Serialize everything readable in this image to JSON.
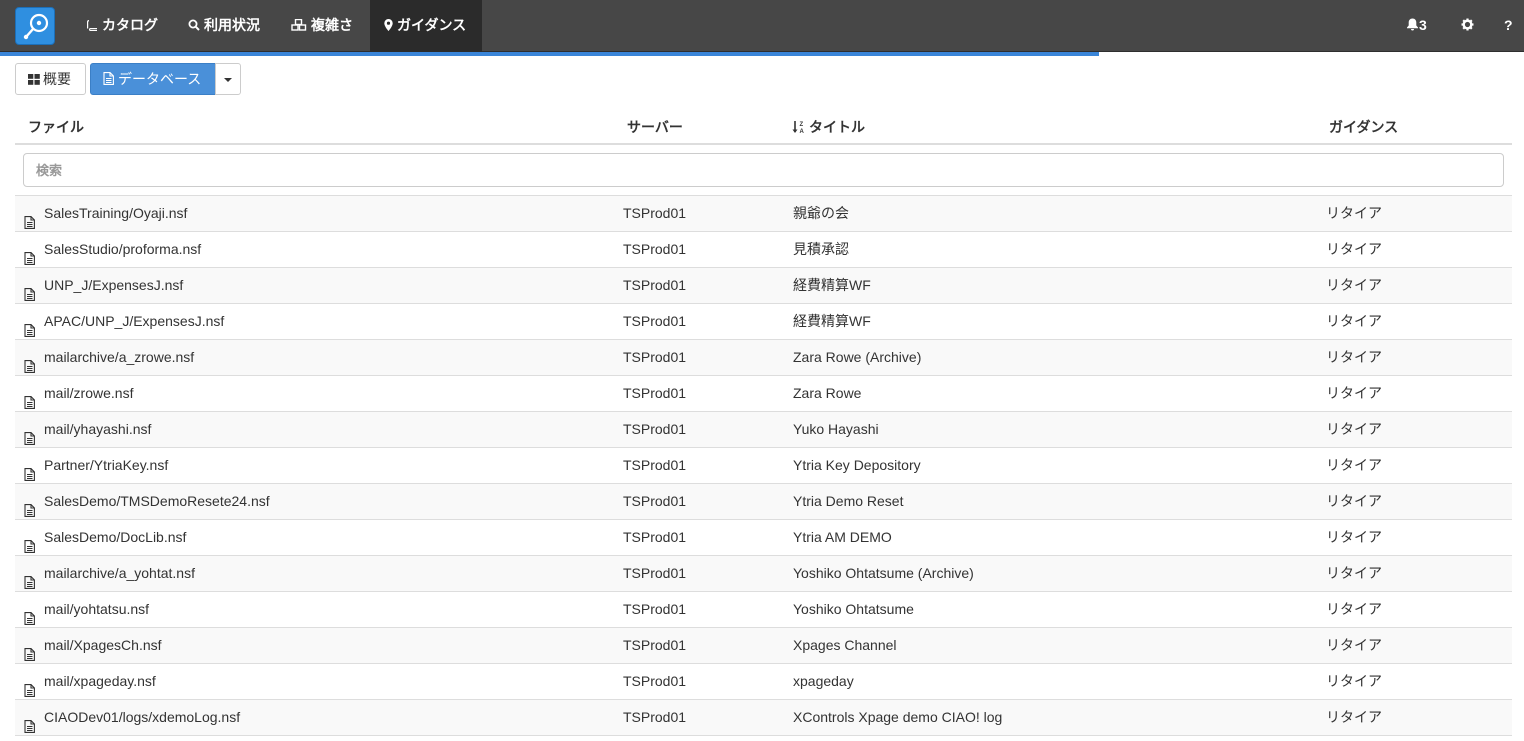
{
  "nav": {
    "items": [
      {
        "label": "カタログ",
        "icon": "book-icon"
      },
      {
        "label": "利用状況",
        "icon": "search-icon"
      },
      {
        "label": "複雑さ",
        "icon": "cubes-icon"
      },
      {
        "label": "ガイダンス",
        "icon": "map-marker-icon",
        "active": true
      }
    ],
    "notifications": "3",
    "help": "?"
  },
  "progress": {
    "fraction": 0.72,
    "color": "#3a85d8"
  },
  "toolbar": {
    "overview_label": "概要",
    "database_label": "データベース"
  },
  "table": {
    "headers": {
      "file": "ファイル",
      "server": "サーバー",
      "title": "タイトル",
      "guidance": "ガイダンス"
    },
    "search_placeholder": "検索",
    "rows": [
      {
        "file": "SalesTraining/Oyaji.nsf",
        "server": "TSProd01",
        "title": "親爺の会",
        "guidance": "リタイア"
      },
      {
        "file": "SalesStudio/proforma.nsf",
        "server": "TSProd01",
        "title": "見積承認",
        "guidance": "リタイア"
      },
      {
        "file": "UNP_J/ExpensesJ.nsf",
        "server": "TSProd01",
        "title": "経費精算WF",
        "guidance": "リタイア"
      },
      {
        "file": "APAC/UNP_J/ExpensesJ.nsf",
        "server": "TSProd01",
        "title": "経費精算WF",
        "guidance": "リタイア"
      },
      {
        "file": "mailarchive/a_zrowe.nsf",
        "server": "TSProd01",
        "title": "Zara Rowe (Archive)",
        "guidance": "リタイア"
      },
      {
        "file": "mail/zrowe.nsf",
        "server": "TSProd01",
        "title": "Zara Rowe",
        "guidance": "リタイア"
      },
      {
        "file": "mail/yhayashi.nsf",
        "server": "TSProd01",
        "title": "Yuko Hayashi",
        "guidance": "リタイア"
      },
      {
        "file": "Partner/YtriaKey.nsf",
        "server": "TSProd01",
        "title": "Ytria Key Depository",
        "guidance": "リタイア"
      },
      {
        "file": "SalesDemo/TMSDemoResete24.nsf",
        "server": "TSProd01",
        "title": "Ytria Demo Reset",
        "guidance": "リタイア"
      },
      {
        "file": "SalesDemo/DocLib.nsf",
        "server": "TSProd01",
        "title": "Ytria AM DEMO",
        "guidance": "リタイア"
      },
      {
        "file": "mailarchive/a_yohtat.nsf",
        "server": "TSProd01",
        "title": "Yoshiko Ohtatsume (Archive)",
        "guidance": "リタイア"
      },
      {
        "file": "mail/yohtatsu.nsf",
        "server": "TSProd01",
        "title": "Yoshiko Ohtatsume",
        "guidance": "リタイア"
      },
      {
        "file": "mail/XpagesCh.nsf",
        "server": "TSProd01",
        "title": "Xpages Channel",
        "guidance": "リタイア"
      },
      {
        "file": "mail/xpageday.nsf",
        "server": "TSProd01",
        "title": "xpageday",
        "guidance": "リタイア"
      },
      {
        "file": "CIAODev01/logs/xdemoLog.nsf",
        "server": "TSProd01",
        "title": "XControls Xpage demo CIAO! log",
        "guidance": "リタイア"
      }
    ]
  }
}
